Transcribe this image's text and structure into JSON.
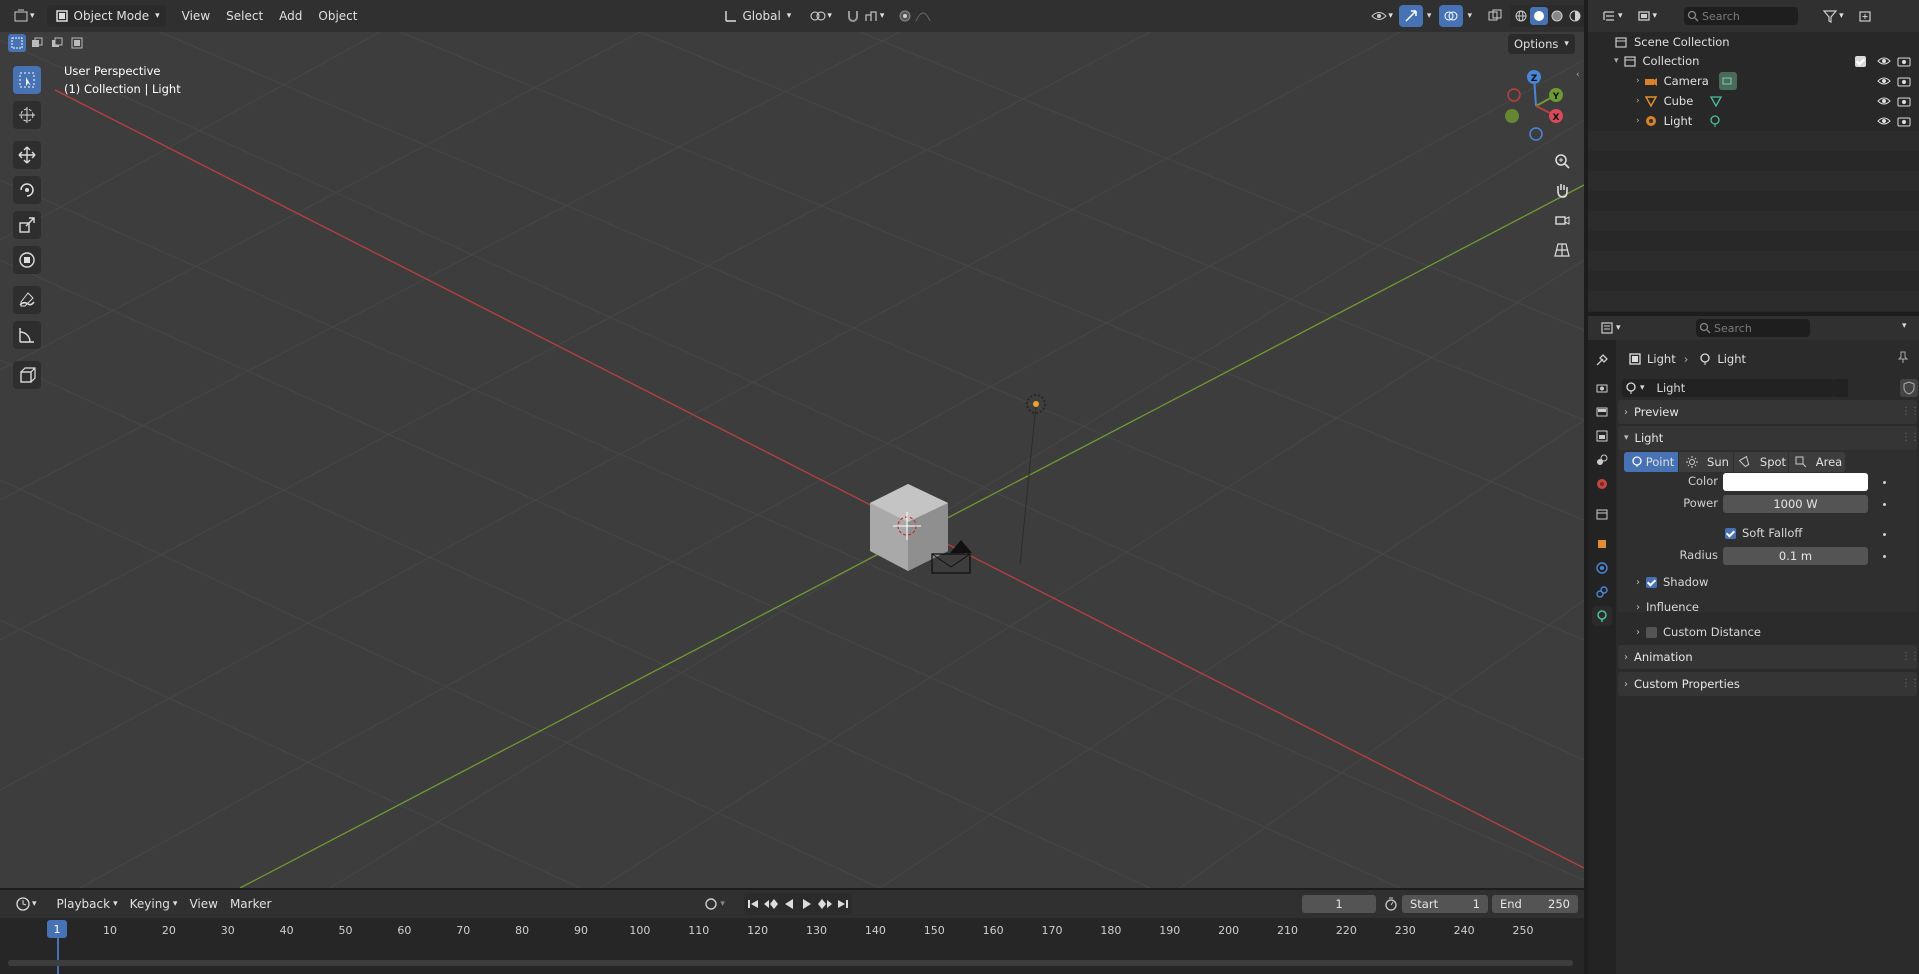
{
  "viewport": {
    "header": {
      "mode": "Object Mode",
      "menus": [
        "View",
        "Select",
        "Add",
        "Object"
      ],
      "orientation": "Global"
    },
    "options_label": "Options",
    "overlay_text": {
      "line1": "User Perspective",
      "line2": "(1) Collection | Light"
    },
    "gizmo": {
      "z": "Z",
      "y": "Y",
      "x": "X"
    }
  },
  "timeline": {
    "menus": [
      "Playback",
      "Keying",
      "View",
      "Marker"
    ],
    "current_frame": "1",
    "start_label": "Start",
    "start_value": "1",
    "end_label": "End",
    "end_value": "250",
    "ticks": [
      "1",
      "10",
      "20",
      "30",
      "40",
      "50",
      "60",
      "70",
      "80",
      "90",
      "100",
      "110",
      "120",
      "130",
      "140",
      "150",
      "160",
      "170",
      "180",
      "190",
      "200",
      "210",
      "220",
      "230",
      "240",
      "250"
    ]
  },
  "outliner": {
    "search_placeholder": "Search",
    "scene_collection": "Scene Collection",
    "collection": "Collection",
    "items": [
      {
        "label": "Camera"
      },
      {
        "label": "Cube"
      },
      {
        "label": "Light"
      }
    ]
  },
  "properties": {
    "search_placeholder": "Search",
    "breadcrumb": {
      "object": "Light",
      "data": "Light"
    },
    "datablock_name": "Light",
    "panels": {
      "preview": "Preview",
      "light": "Light",
      "animation": "Animation",
      "custom_properties": "Custom Properties"
    },
    "light_types": [
      "Point",
      "Sun",
      "Spot",
      "Area"
    ],
    "active_type": "Point",
    "fields": {
      "color_label": "Color",
      "color_value": "#ffffff",
      "power_label": "Power",
      "power_value": "1000 W",
      "soft_falloff_label": "Soft Falloff",
      "soft_falloff": true,
      "radius_label": "Radius",
      "radius_value": "0.1 m"
    },
    "subpanels": {
      "shadow": "Shadow",
      "shadow_enabled": true,
      "influence": "Influence",
      "custom_distance": "Custom Distance",
      "custom_distance_enabled": false
    }
  },
  "colors": {
    "accent": "#4772b3",
    "x_axis": "#b83f3f",
    "y_axis": "#6f9a32",
    "z_axis": "#4a86d8"
  }
}
